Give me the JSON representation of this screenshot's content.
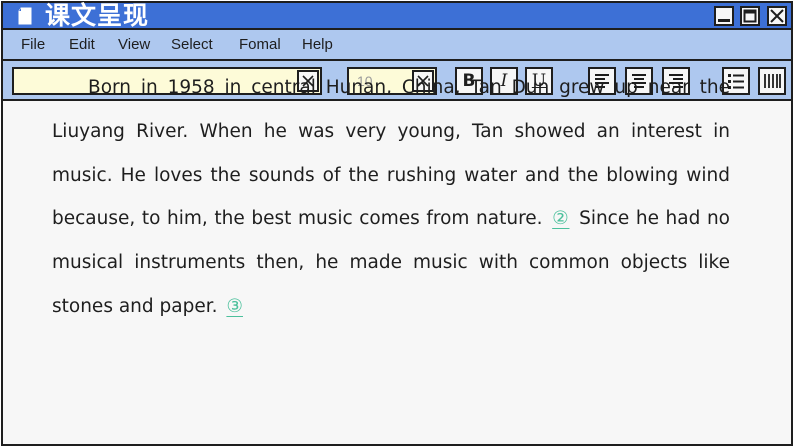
{
  "window": {
    "title": "课文呈现",
    "icon": "document-icon",
    "controls": [
      "minimize-icon",
      "maximize-icon",
      "close-icon"
    ]
  },
  "menu": {
    "items": [
      "File",
      "Edit",
      "View",
      "Select",
      "Fomal",
      "Help"
    ]
  },
  "toolbar": {
    "font_size": "10",
    "bold_label": "B",
    "italic_label": "I",
    "underline_label": "U",
    "icons": [
      "align-left-icon",
      "align-center-icon",
      "align-right-icon",
      "list-icon",
      "columns-icon"
    ]
  },
  "document": {
    "text_1": "Born in 1958 in central Hunan, China, Tan Dun grew up near the Liuyang River. When he was very young, Tan showed an interest in music. He loves the sounds of the rushing water and the blowing wind because, to him, the best music comes from nature.",
    "blank_2": "②",
    "text_2": "Since he had no musical instruments then, he made music with common objects like stones and paper.",
    "blank_3": "③"
  },
  "colors": {
    "titlebar": "#3d70d6",
    "menubar": "#aec8ef",
    "input_bg": "#fdfbd8",
    "marker": "#4cc09c"
  }
}
